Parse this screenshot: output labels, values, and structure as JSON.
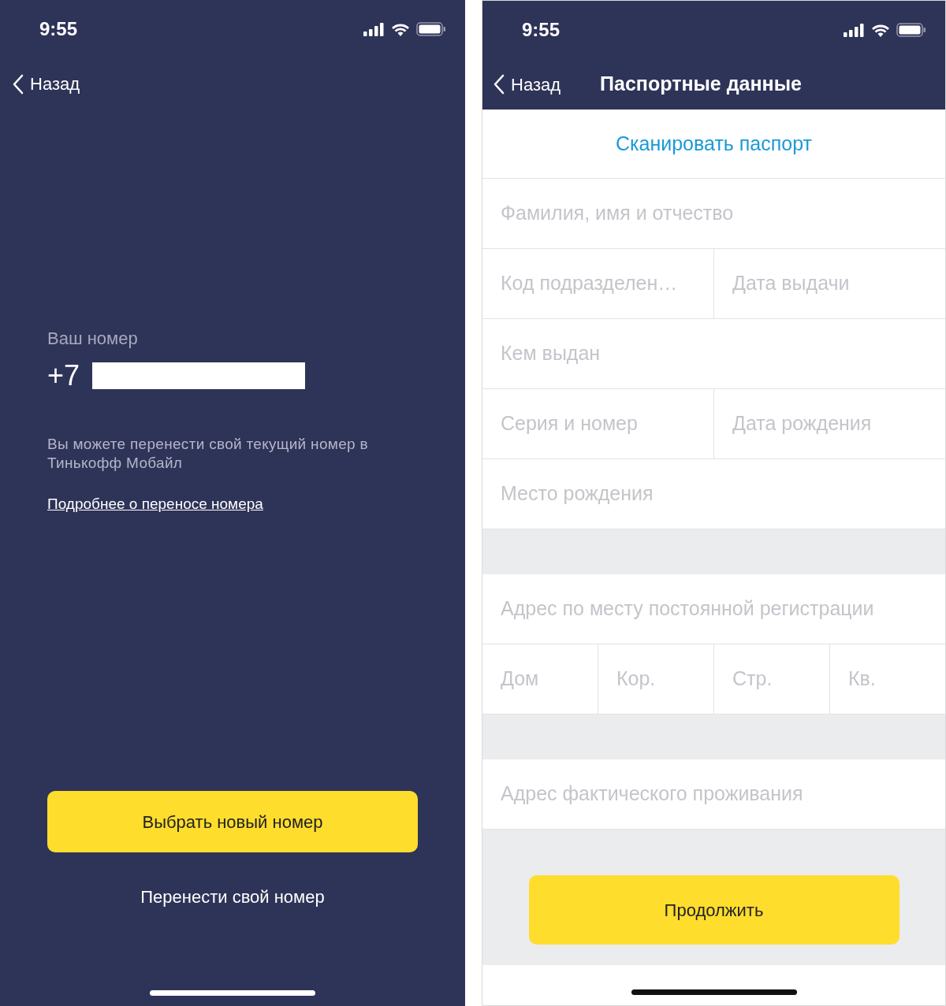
{
  "left_screen": {
    "status_bar": {
      "time": "9:55"
    },
    "back": "Назад",
    "number_label": "Ваш номер",
    "number_prefix": "+7",
    "description": "Вы можете перенести свой текущий номер в Тинькофф Мобайл",
    "link": "Подробнее о переносе номера",
    "primary_button": "Выбрать новый номер",
    "secondary_button": "Перенести свой номер"
  },
  "right_screen": {
    "status_bar": {
      "time": "9:55"
    },
    "back": "Назад",
    "title": "Паспортные данные",
    "scan_link": "Сканировать паспорт",
    "form_groups": [
      [
        [
          {
            "placeholder": "Фамилия, имя и отчество"
          }
        ],
        [
          {
            "placeholder": "Код подразделен…"
          },
          {
            "placeholder": "Дата выдачи"
          }
        ],
        [
          {
            "placeholder": "Кем выдан"
          }
        ],
        [
          {
            "placeholder": "Серия и номер"
          },
          {
            "placeholder": "Дата рождения"
          }
        ],
        [
          {
            "placeholder": "Место рождения"
          }
        ]
      ],
      [
        [
          {
            "placeholder": "Адрес по месту постоянной регистрации"
          }
        ],
        [
          {
            "placeholder": "Дом"
          },
          {
            "placeholder": "Кор."
          },
          {
            "placeholder": "Стр."
          },
          {
            "placeholder": "Кв."
          }
        ]
      ],
      [
        [
          {
            "placeholder": "Адрес фактического проживания"
          }
        ]
      ]
    ],
    "continue_button": "Продолжить"
  }
}
